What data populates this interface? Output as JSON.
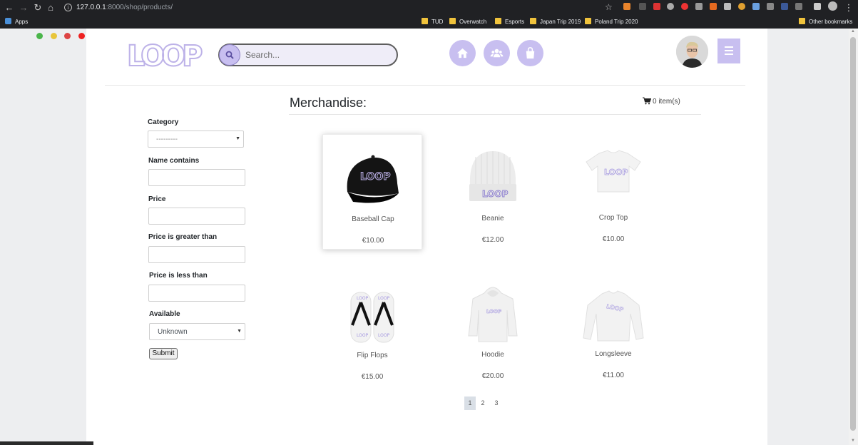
{
  "browser": {
    "url_host": "127.0.0.1",
    "url_rest": ":8000/shop/products/",
    "bookmarks": {
      "apps": "Apps",
      "tud": "TUD",
      "overwatch": "Overwatch",
      "esports": "Esports",
      "japan": "Japan Trip 2019",
      "poland": "Poland Trip 2020",
      "other": "Other bookmarks"
    }
  },
  "header": {
    "logo": "LOOP",
    "search_placeholder": "Search...",
    "accent": "#c8bff0"
  },
  "filters": {
    "category_label": "Category",
    "category_value": "---------",
    "name_label": "Name contains",
    "price_label": "Price",
    "price_gt_label": "Price is greater than",
    "price_lt_label": "Price is less than",
    "available_label": "Available",
    "available_value": "Unknown",
    "submit": "Submit"
  },
  "merch": {
    "title": "Merchandise:",
    "cart": "0 item(s)",
    "products": [
      {
        "name": "Baseball Cap",
        "price": "€10.00",
        "icon": "baseball-cap-image"
      },
      {
        "name": "Beanie",
        "price": "€12.00",
        "icon": "beanie-image"
      },
      {
        "name": "Crop Top",
        "price": "€10.00",
        "icon": "crop-top-image"
      },
      {
        "name": "Flip Flops",
        "price": "€15.00",
        "icon": "flip-flops-image"
      },
      {
        "name": "Hoodie",
        "price": "€20.00",
        "icon": "hoodie-image"
      },
      {
        "name": "Longsleeve",
        "price": "€11.00",
        "icon": "longsleeve-image"
      }
    ],
    "pages": [
      "1",
      "2",
      "3"
    ],
    "active_page": "1"
  }
}
